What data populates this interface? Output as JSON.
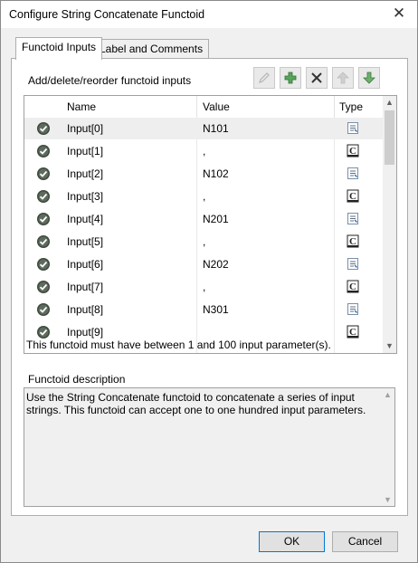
{
  "window": {
    "title": "Configure String Concatenate Functoid"
  },
  "tabs": [
    {
      "label": "Functoid Inputs",
      "active": true
    },
    {
      "label": "Label and Comments",
      "active": false
    }
  ],
  "inputs_panel": {
    "section_label": "Add/delete/reorder functoid inputs",
    "toolbar": [
      {
        "name": "edit-input",
        "icon": "pencil-icon",
        "enabled": false
      },
      {
        "name": "add-input",
        "icon": "plus-icon",
        "enabled": true
      },
      {
        "name": "delete-input",
        "icon": "x-icon",
        "enabled": true
      },
      {
        "name": "move-up",
        "icon": "arrow-up-icon",
        "enabled": false
      },
      {
        "name": "move-down",
        "icon": "arrow-down-icon",
        "enabled": true
      }
    ],
    "columns": {
      "name": "Name",
      "value": "Value",
      "type": "Type"
    },
    "rows": [
      {
        "name": "Input[0]",
        "value": "N101",
        "type": "link-icon",
        "selected": true
      },
      {
        "name": "Input[1]",
        "value": ",",
        "type": "constant-icon"
      },
      {
        "name": "Input[2]",
        "value": "N102",
        "type": "link-icon"
      },
      {
        "name": "Input[3]",
        "value": ",",
        "type": "constant-icon"
      },
      {
        "name": "Input[4]",
        "value": "N201",
        "type": "link-icon"
      },
      {
        "name": "Input[5]",
        "value": ",",
        "type": "constant-icon"
      },
      {
        "name": "Input[6]",
        "value": "N202",
        "type": "link-icon"
      },
      {
        "name": "Input[7]",
        "value": ",",
        "type": "constant-icon"
      },
      {
        "name": "Input[8]",
        "value": "N301",
        "type": "link-icon"
      },
      {
        "name": "Input[9]",
        "value": "",
        "type": "constant-icon"
      }
    ],
    "info_text": "This functoid must have between 1 and 100 input parameter(s)."
  },
  "description": {
    "label": "Functoid description",
    "text": "Use the String Concatenate functoid to concatenate a series of input strings. This functoid can accept one to one hundred input parameters."
  },
  "buttons": {
    "ok": "OK",
    "cancel": "Cancel"
  },
  "colors": {
    "accent": "#0078d7",
    "status_green": "#2e7d32"
  }
}
